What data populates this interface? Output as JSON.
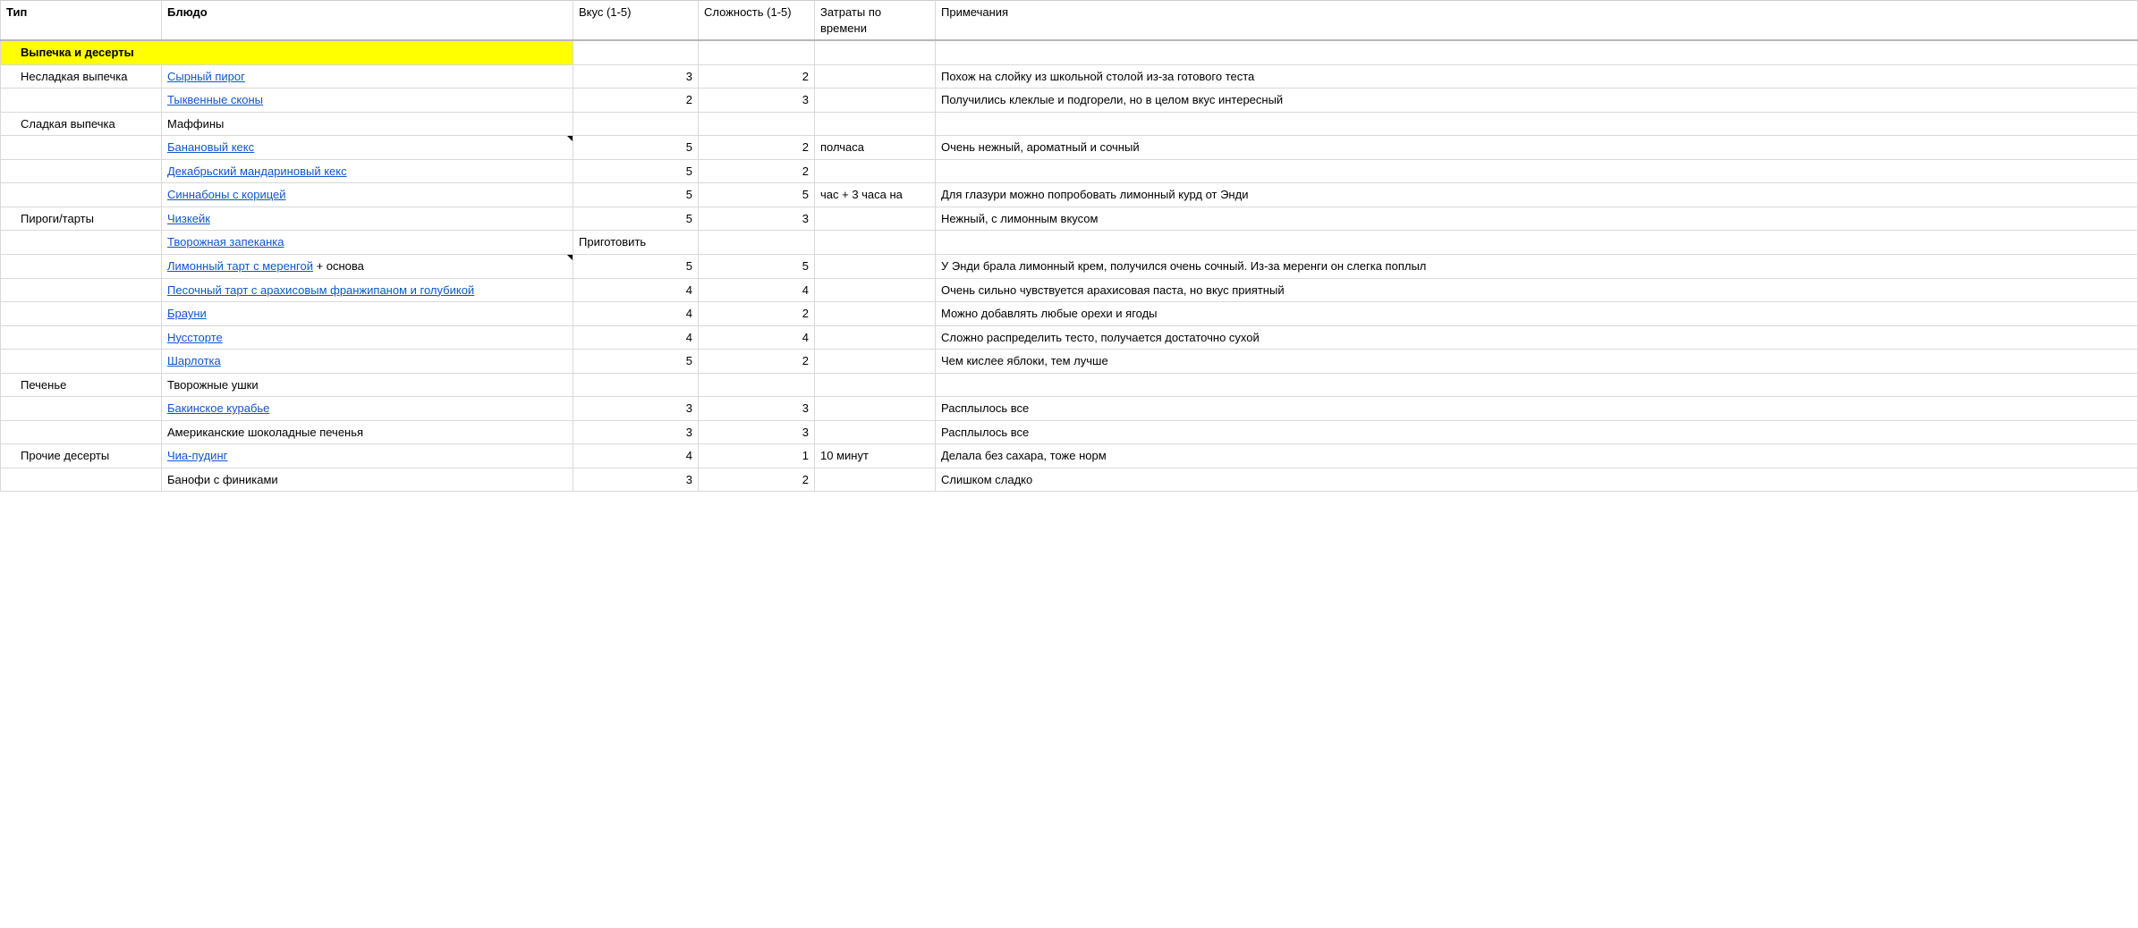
{
  "headers": {
    "type": "Тип",
    "dish": "Блюдо",
    "taste": "Вкус (1-5)",
    "difficulty": "Сложность (1-5)",
    "time": "Затраты по времени",
    "notes": "Примечания"
  },
  "section_header": "Выпечка и десерты",
  "rows": [
    {
      "type": "Несладкая выпечка",
      "dish": "Сырный пирог",
      "link": true,
      "suffix": "",
      "taste": "3",
      "difficulty": "2",
      "time": "",
      "notes": "Похож на слойку из школьной столой из-за готового теста",
      "flag": false
    },
    {
      "type": "",
      "dish": "Тыквенные сконы",
      "link": true,
      "suffix": "",
      "taste": "2",
      "difficulty": "3",
      "time": "",
      "notes": "Получились клеклые и подгорели, но в целом вкус интересный",
      "flag": false
    },
    {
      "type": "Сладкая выпечка",
      "dish": "Маффины",
      "link": false,
      "suffix": "",
      "taste": "",
      "difficulty": "",
      "time": "",
      "notes": "",
      "flag": false
    },
    {
      "type": "",
      "dish": "Банановый кекс",
      "link": true,
      "suffix": "",
      "taste": "5",
      "difficulty": "2",
      "time": "полчаса",
      "notes": "Очень нежный, ароматный и сочный",
      "flag": true
    },
    {
      "type": "",
      "dish": "Декабрьский мандариновый кекс",
      "link": true,
      "suffix": "",
      "taste": "5",
      "difficulty": "2",
      "time": "",
      "notes": "",
      "flag": false
    },
    {
      "type": "",
      "dish": "Синнабоны с корицей",
      "link": true,
      "suffix": "",
      "taste": "5",
      "difficulty": "5",
      "time": "час + 3 часа на",
      "notes": "Для глазури можно попробовать лимонный курд от Энди",
      "flag": false
    },
    {
      "type": "Пироги/тарты",
      "dish": "Чизкейк",
      "link": true,
      "suffix": "",
      "taste": "5",
      "difficulty": "3",
      "time": "",
      "notes": "Нежный, с лимонным вкусом",
      "flag": false
    },
    {
      "type": "",
      "dish": "Творожная запеканка",
      "link": true,
      "suffix": "",
      "taste": "Приготовить",
      "taste_left": true,
      "difficulty": "",
      "time": "",
      "notes": "",
      "flag": false
    },
    {
      "type": "",
      "dish": "Лимонный тарт с меренгой",
      "link": true,
      "suffix": " + основа",
      "taste": "5",
      "difficulty": "5",
      "time": "",
      "notes": "У Энди брала лимонный крем, получился очень сочный. Из-за меренги он слегка поплыл",
      "flag": true
    },
    {
      "type": "",
      "dish": "Песочный тарт с арахисовым франжипаном и голубикой",
      "link": true,
      "suffix": "",
      "taste": "4",
      "difficulty": "4",
      "time": "",
      "notes": "Очень сильно чувствуется арахисовая паста, но вкус приятный",
      "flag": false
    },
    {
      "type": "",
      "dish": "Брауни",
      "link": true,
      "suffix": "",
      "taste": "4",
      "difficulty": "2",
      "time": "",
      "notes": "Можно добавлять любые орехи и ягоды",
      "flag": false
    },
    {
      "type": "",
      "dish": "Нуссторте",
      "link": true,
      "suffix": "",
      "taste": "4",
      "difficulty": "4",
      "time": "",
      "notes": "Сложно распределить тесто, получается достаточно сухой",
      "flag": false
    },
    {
      "type": "",
      "dish": "Шарлотка",
      "link": true,
      "suffix": "",
      "taste": "5",
      "difficulty": "2",
      "time": "",
      "notes": "Чем кислее яблоки, тем лучше",
      "flag": false
    },
    {
      "type": "Печенье",
      "dish": "Творожные ушки",
      "link": false,
      "suffix": "",
      "taste": "",
      "difficulty": "",
      "time": "",
      "notes": "",
      "flag": false
    },
    {
      "type": "",
      "dish": "Бакинское курабье",
      "link": true,
      "suffix": "",
      "taste": "3",
      "difficulty": "3",
      "time": "",
      "notes": "Расплылось все",
      "flag": false
    },
    {
      "type": "",
      "dish": "Американские шоколадные печенья",
      "link": false,
      "suffix": "",
      "taste": "3",
      "difficulty": "3",
      "time": "",
      "notes": "Расплылось все",
      "flag": false
    },
    {
      "type": "Прочие десерты",
      "dish": "Чиа-пудинг",
      "link": true,
      "suffix": "",
      "taste": "4",
      "difficulty": "1",
      "time": "10 минут",
      "notes": "Делала без сахара, тоже норм",
      "flag": false
    },
    {
      "type": "",
      "dish": "Банофи с финиками",
      "link": false,
      "suffix": "",
      "taste": "3",
      "difficulty": "2",
      "time": "",
      "notes": "Слишком сладко",
      "flag": false
    }
  ]
}
